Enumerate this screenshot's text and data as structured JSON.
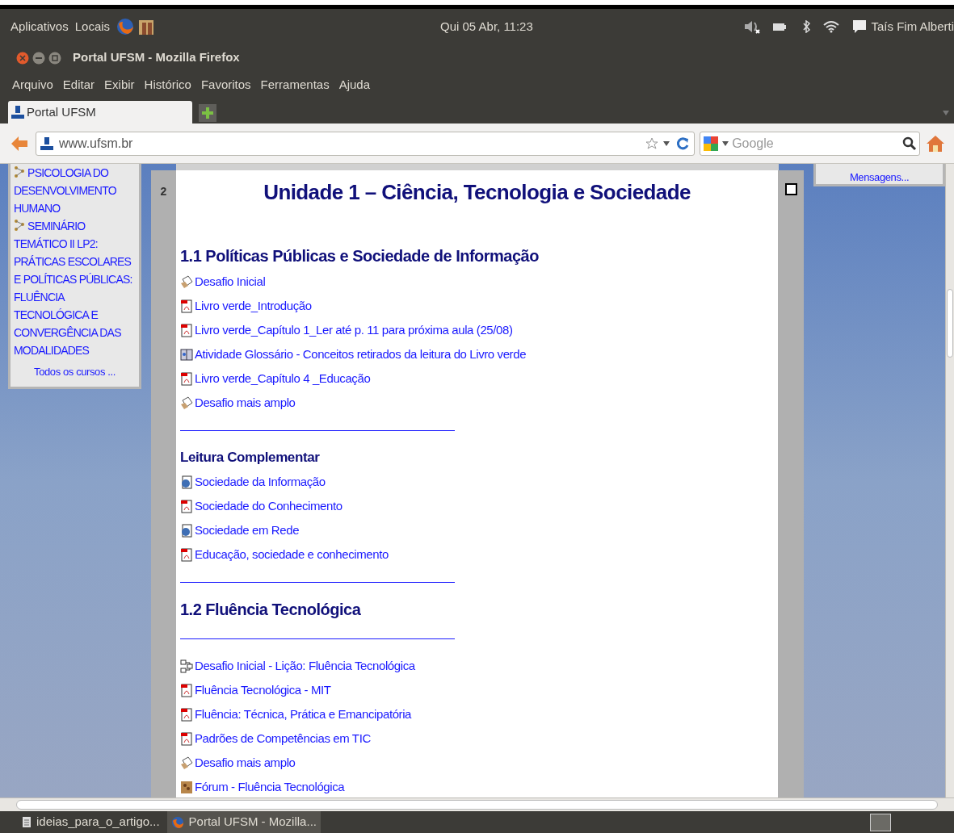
{
  "top_panel": {
    "menus": [
      "Aplicativos",
      "Locais"
    ],
    "clock": "Qui 05 Abr, 11:23",
    "user": "Taís Fim Alberti"
  },
  "window": {
    "title": "Portal UFSM - Mozilla Firefox"
  },
  "menu_bar": [
    "Arquivo",
    "Editar",
    "Exibir",
    "Histórico",
    "Favoritos",
    "Ferramentas",
    "Ajuda"
  ],
  "tabs": [
    {
      "label": "Portal UFSM",
      "selected": true
    }
  ],
  "address_bar": {
    "url": "www.ufsm.br"
  },
  "search": {
    "placeholder": "Google"
  },
  "sidebar": {
    "courses": [
      {
        "name": "PSICOLOGIA DO DESENVOLVIMENTO HUMANO"
      },
      {
        "name": "SEMINÁRIO TEMÁTICO II LP2: PRÁTICAS ESCOLARES E POLÍTICAS PÚBLICAS: FLUÊNCIA TECNOLÓGICA E CONVERGÊNCIA DAS MODALIDADES"
      }
    ],
    "all_courses": "Todos os cursos ..."
  },
  "right_block": {
    "link": "Mensagens..."
  },
  "section": {
    "number": "2",
    "checked": false,
    "title": "Unidade 1 – Ciência, Tecnologia e Sociedade",
    "blocks": [
      {
        "kind": "heading",
        "text": "1.1 Políticas Públicas e Sociedade de Informação"
      },
      {
        "kind": "forum",
        "text": "Desafio Inicial"
      },
      {
        "kind": "pdf",
        "text": "Livro verde_Introdução"
      },
      {
        "kind": "pdf",
        "text": "Livro verde_Capítulo 1_Ler até p. 11 para próxima aula (25/08)"
      },
      {
        "kind": "glossary",
        "text": "Atividade Glossário - Conceitos retirados da leitura do Livro verde"
      },
      {
        "kind": "pdf",
        "text": "Livro verde_Capítulo 4 _Educação"
      },
      {
        "kind": "forum",
        "text": "Desafio mais amplo"
      },
      {
        "kind": "divider"
      },
      {
        "kind": "subheading",
        "text": "Leitura Complementar"
      },
      {
        "kind": "web",
        "text": "Sociedade da Informação"
      },
      {
        "kind": "pdf",
        "text": "Sociedade do Conhecimento"
      },
      {
        "kind": "web",
        "text": "Sociedade em Rede"
      },
      {
        "kind": "pdf",
        "text": "Educação, sociedade e conhecimento"
      },
      {
        "kind": "divider"
      },
      {
        "kind": "heading",
        "text": "1.2 Fluência Tecnológica"
      },
      {
        "kind": "divider"
      },
      {
        "kind": "lesson",
        "text": "Desafio Inicial - Lição: Fluência Tecnológica"
      },
      {
        "kind": "pdf",
        "text": "Fluência Tecnológica - MIT"
      },
      {
        "kind": "pdf",
        "text": "Fluência: Técnica, Prática e Emancipatória"
      },
      {
        "kind": "pdf",
        "text": "Padrões de Competências em TIC"
      },
      {
        "kind": "forum",
        "text": "Desafio mais amplo"
      },
      {
        "kind": "discussion",
        "text": "Fórum - Fluência Tecnológica"
      }
    ]
  },
  "taskbar": [
    {
      "label": "ideias_para_o_artigo...",
      "selected": false
    },
    {
      "label": "Portal UFSM - Mozilla...",
      "selected": true
    }
  ]
}
